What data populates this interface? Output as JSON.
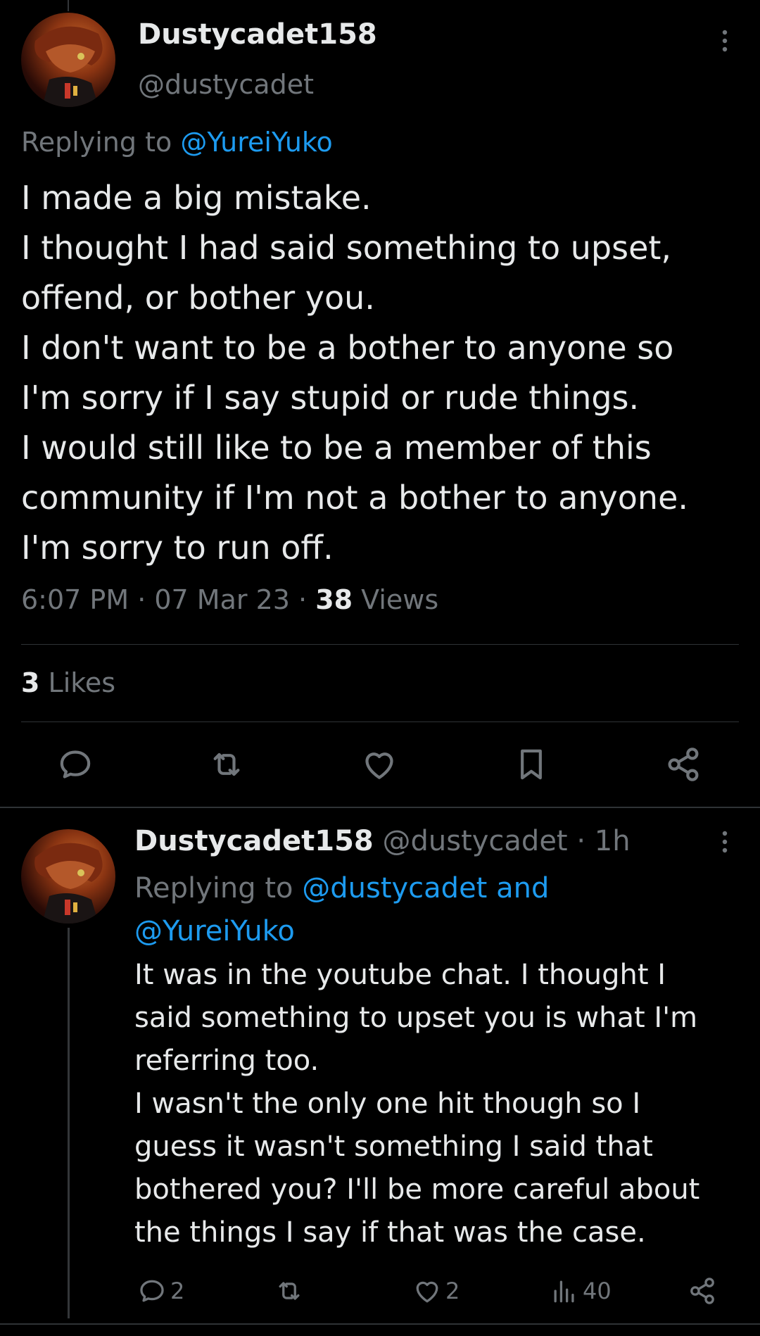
{
  "main_tweet": {
    "display_name": "Dustycadet158",
    "handle": "@dustycadet",
    "replying_prefix": "Replying to ",
    "replying_to": "@YureiYuko",
    "body_lines": [
      "I made a big mistake.",
      "I thought I had said something to upset,",
      "offend, or bother you.",
      "I don't want to be a bother to anyone so",
      "I'm sorry if I say stupid or rude things.",
      "I would still like to be a member of this",
      "community if I'm not a bother to anyone.",
      "I'm sorry to run off."
    ],
    "time": "6:07 PM",
    "separator": " · ",
    "date": "07 Mar 23",
    "views_count": "38",
    "views_label": " Views",
    "likes_count": "3",
    "likes_label": " Likes",
    "actions": [
      "reply-icon",
      "retweet-icon",
      "like-icon",
      "bookmark-icon",
      "share-icon"
    ]
  },
  "reply_tweet": {
    "display_name": "Dustycadet158",
    "handle_time": " @dustycadet · 1h",
    "replying_prefix": "Replying to ",
    "replying_to_1": "@dustycadet and",
    "replying_to_2": "@YureiYuko",
    "body_lines": [
      "It was in the youtube chat. I thought I",
      "said something to upset you is what I'm",
      "referring too.",
      "I wasn't the only one hit though so I",
      "guess it wasn't something I said that",
      "bothered you? I'll be more careful about",
      "the things I say if that was the case."
    ],
    "reply_count": "2",
    "like_count": "2",
    "view_count": "40"
  },
  "colors": {
    "background": "#000000",
    "text": "#e7e9ea",
    "muted": "#71767b",
    "link": "#1d9bf0",
    "border": "#2f3336"
  }
}
